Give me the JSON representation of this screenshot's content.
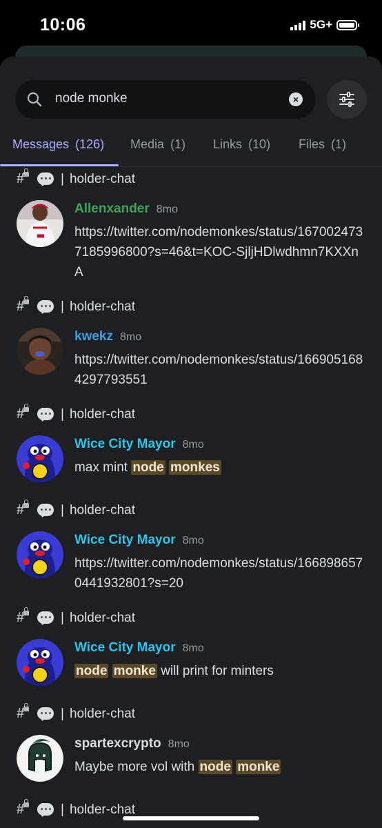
{
  "status_bar": {
    "time": "10:06",
    "network": "5G+"
  },
  "search": {
    "query": "node monke",
    "clear_glyph": "×"
  },
  "tabs": [
    {
      "label": "Messages",
      "count": "(126)"
    },
    {
      "label": "Media",
      "count": "(1)"
    },
    {
      "label": "Links",
      "count": "(10)"
    },
    {
      "label": "Files",
      "count": "(1)"
    }
  ],
  "colors": {
    "accent": "#a8b0ff",
    "highlight": "#5b4a2a",
    "author_green": "#3ba55c",
    "author_blue": "#3aa0e0",
    "author_cyan": "#2ac6e8",
    "author_white": "#dbdee1"
  },
  "results": [
    {
      "channel": "holder-chat",
      "separator": "|",
      "author": "Allenxander",
      "author_color": "#3ba55c",
      "time": "8mo",
      "avatar_icon": "basketball-player-avatar",
      "body": "https://twitter.com/nodemonkes/status/1670024737185996800?s=46&t=KOC-SjljHDlwdhmn7KXXnA"
    },
    {
      "channel": "holder-chat",
      "separator": "|",
      "author": "kwekz",
      "author_color": "#3aa0e0",
      "time": "8mo",
      "avatar_icon": "wrestler-avatar",
      "body": "https://twitter.com/nodemonkes/status/1669051684297793551"
    },
    {
      "channel": "holder-chat",
      "separator": "|",
      "author": "Wice City Mayor",
      "author_color": "#2ac6e8",
      "time": "8mo",
      "avatar_icon": "penguin-avatar",
      "body_pre": "max mint ",
      "hl1": "node",
      "hl2": "monkes",
      "body_post": ""
    },
    {
      "channel": "holder-chat",
      "separator": "|",
      "author": "Wice City Mayor",
      "author_color": "#2ac6e8",
      "time": "8mo",
      "avatar_icon": "penguin-avatar",
      "body": "https://twitter.com/nodemonkes/status/1668986570441932801?s=20"
    },
    {
      "channel": "holder-chat",
      "separator": "|",
      "author": "Wice City Mayor",
      "author_color": "#2ac6e8",
      "time": "8mo",
      "avatar_icon": "penguin-avatar",
      "body_pre": "",
      "hl1": "node",
      "hl2": "monke",
      "body_post": " will print for minters"
    },
    {
      "channel": "holder-chat",
      "separator": "|",
      "author": "spartexcrypto",
      "author_color": "#dbdee1",
      "time": "8mo",
      "avatar_icon": "spartan-helmet-avatar",
      "body_pre": "Maybe more vol with ",
      "hl1": "node",
      "hl2": "monke",
      "body_post": ""
    },
    {
      "channel": "holder-chat",
      "separator": "|"
    }
  ]
}
